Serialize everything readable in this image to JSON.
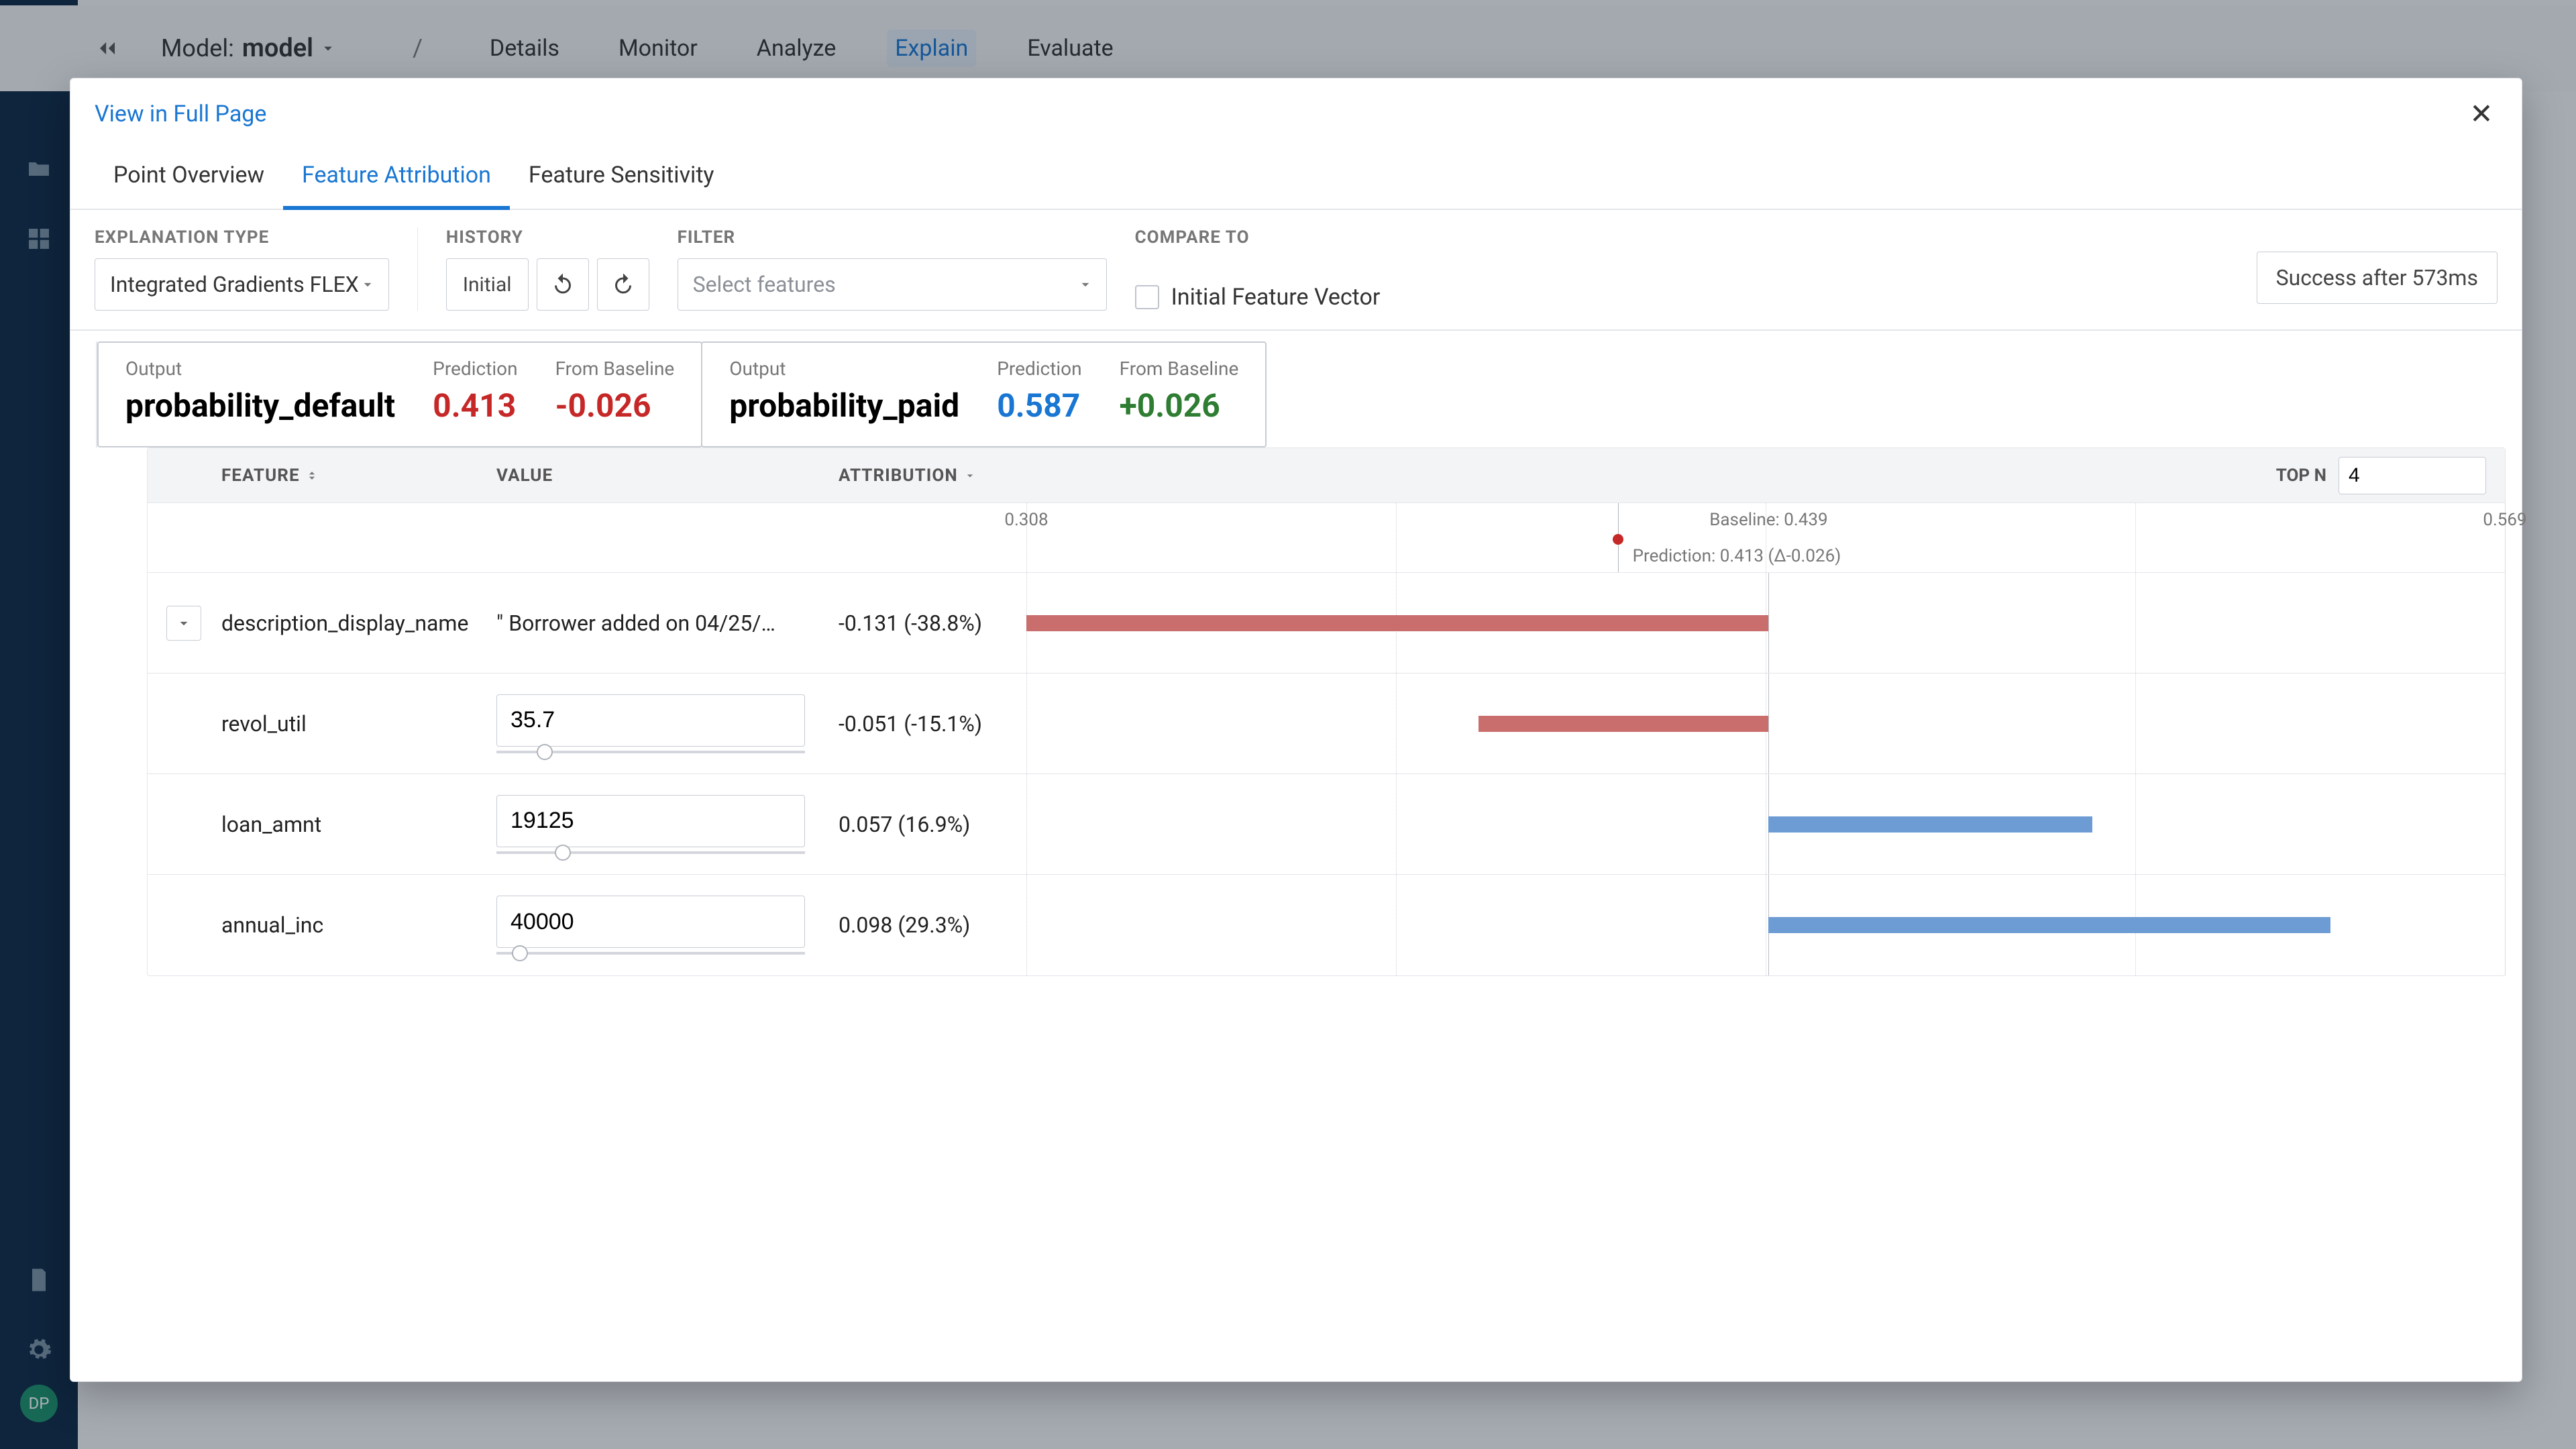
{
  "topbar": {
    "model_label": "Model:",
    "model_name": "model",
    "sep": "/",
    "tabs": [
      "Details",
      "Monitor",
      "Analyze",
      "Explain",
      "Evaluate"
    ],
    "active_tab_index": 3,
    "avatar_initials": "DP"
  },
  "dialog": {
    "view_full_page": "View in Full Page",
    "tabs": [
      "Point Overview",
      "Feature Attribution",
      "Feature Sensitivity"
    ],
    "active_tab_index": 1,
    "explanation_type_label": "EXPLANATION TYPE",
    "explanation_type_value": "Integrated Gradients FLEX",
    "history_label": "HISTORY",
    "history_initial": "Initial",
    "filter_label": "FILTER",
    "filter_placeholder": "Select features",
    "compare_label": "COMPARE TO",
    "compare_check_label": "Initial Feature Vector",
    "status_text": "Success after 573ms"
  },
  "pred_cards": [
    {
      "output_label": "Output",
      "output_value": "probability_default",
      "pred_label": "Prediction",
      "pred_value": "0.413",
      "pred_class": "neg",
      "base_label": "From Baseline",
      "base_value": "-0.026",
      "base_class": "neg"
    },
    {
      "output_label": "Output",
      "output_value": "probability_paid",
      "pred_label": "Prediction",
      "pred_value": "0.587",
      "pred_class": "blu",
      "base_label": "From Baseline",
      "base_value": "+0.026",
      "base_class": "pos"
    }
  ],
  "table": {
    "head": {
      "feature": "FEATURE",
      "value": "VALUE",
      "attribution": "ATTRIBUTION",
      "topn_label": "TOP N",
      "topn_value": "4"
    },
    "scale": {
      "min_label": "0.308",
      "min_pct": 0.0,
      "baseline_label": "Baseline: 0.439",
      "baseline_pct": 50.2,
      "pred_label": "Prediction: 0.413 (Δ-0.026)",
      "pred_pct": 40.0,
      "max_label": "0.569",
      "max_pct": 100.0,
      "grid_pcts": [
        0,
        25,
        50,
        75,
        100
      ]
    },
    "rows": [
      {
        "feature": "description_display_name",
        "has_chevron": true,
        "value_type": "text",
        "value_text": "\" Borrower added on 04/25/…",
        "attr_val": "-0.131",
        "attr_pct": "(-38.8%)",
        "bar_dir": "neg",
        "bar_from_pct": 0.0,
        "bar_to_pct": 50.2
      },
      {
        "feature": "revol_util",
        "has_chevron": false,
        "value_type": "input",
        "value_text": "35.7",
        "slider_pct": 13,
        "attr_val": "-0.051",
        "attr_pct": "(-15.1%)",
        "bar_dir": "neg",
        "bar_from_pct": 30.6,
        "bar_to_pct": 50.2
      },
      {
        "feature": "loan_amnt",
        "has_chevron": false,
        "value_type": "input",
        "value_text": "19125",
        "slider_pct": 19,
        "attr_val": "0.057",
        "attr_pct": "(16.9%)",
        "bar_dir": "pos",
        "bar_from_pct": 50.2,
        "bar_to_pct": 72.1
      },
      {
        "feature": "annual_inc",
        "has_chevron": false,
        "value_type": "input",
        "value_text": "40000",
        "slider_pct": 5,
        "attr_val": "0.098",
        "attr_pct": "(29.3%)",
        "bar_dir": "pos",
        "bar_from_pct": 50.2,
        "bar_to_pct": 88.2
      }
    ]
  },
  "chart_data": {
    "type": "bar",
    "title": "Feature Attribution — probability_default",
    "xlabel": "attribution",
    "categories": [
      "description_display_name",
      "revol_util",
      "loan_amnt",
      "annual_inc"
    ],
    "values": [
      -0.131,
      -0.051,
      0.057,
      0.098
    ],
    "percent": [
      -38.8,
      -15.1,
      16.9,
      29.3
    ],
    "xlim": [
      0.308,
      0.569
    ],
    "baseline": 0.439,
    "prediction": 0.413,
    "delta_from_baseline": -0.026
  }
}
